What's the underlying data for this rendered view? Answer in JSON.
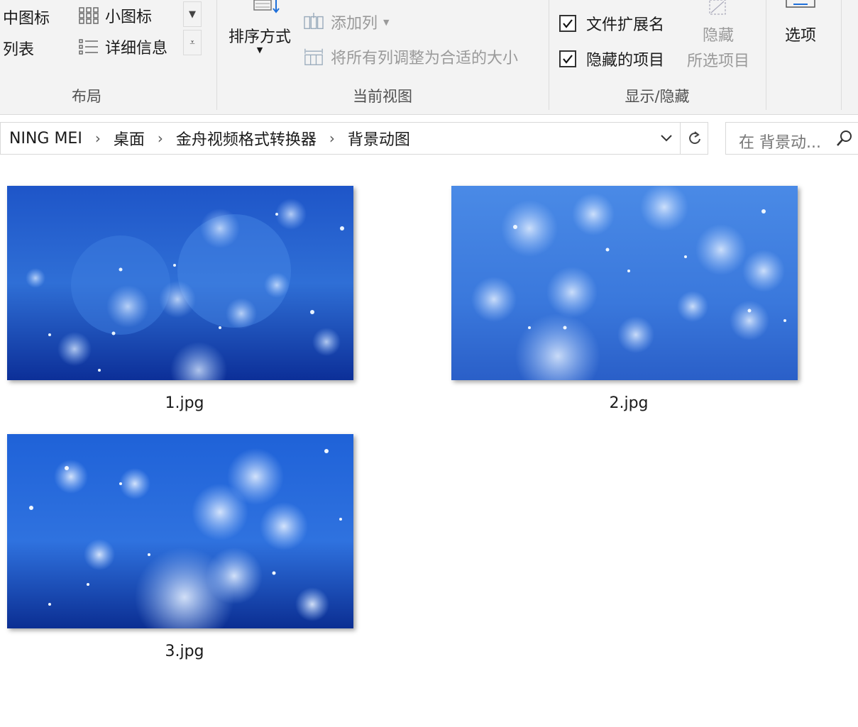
{
  "ribbon": {
    "layout": {
      "label": "布局",
      "items": [
        "中图标",
        "小图标",
        "列表",
        "详细信息"
      ]
    },
    "current_view": {
      "label": "当前视图",
      "sort_by": "排序方式",
      "add_columns": "添加列",
      "size_all_columns": "将所有列调整为合适的大小"
    },
    "show_hide": {
      "label": "显示/隐藏",
      "file_extensions": "文件扩展名",
      "file_extensions_checked": true,
      "hidden_items": "隐藏的项目",
      "hidden_items_checked": true,
      "hide_selected_line1": "隐藏",
      "hide_selected_line2": "所选项目"
    },
    "options": "选项"
  },
  "address": {
    "crumbs": [
      "NING MEI",
      "桌面",
      "金舟视频格式转换器",
      "背景动图"
    ]
  },
  "search": {
    "placeholder": "在 背景动..."
  },
  "files": [
    {
      "name": "1.jpg",
      "icon": "image-thumbnail"
    },
    {
      "name": "2.jpg",
      "icon": "image-thumbnail"
    },
    {
      "name": "3.jpg",
      "icon": "image-thumbnail"
    }
  ],
  "colors": {
    "ribbon_bg": "#f3f3f3",
    "thumb_blue_dark": "#0a2a8c",
    "thumb_blue_mid": "#2f6fd6",
    "thumb_blue_light": "#9cc4ff"
  }
}
